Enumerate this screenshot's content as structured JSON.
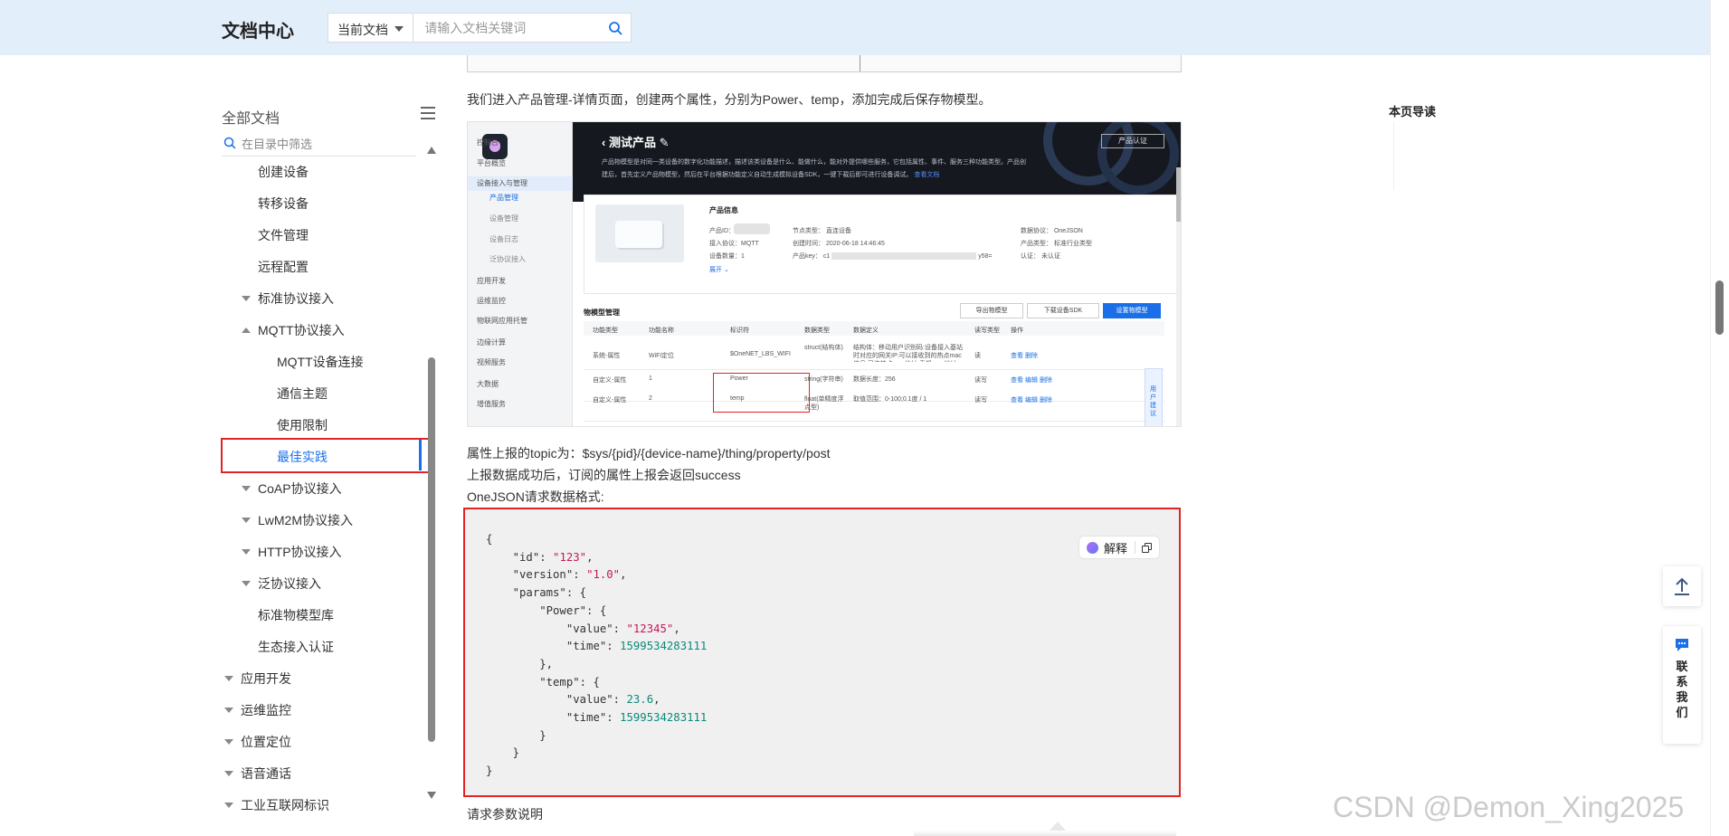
{
  "header": {
    "logo": "文档中心",
    "scope_label": "当前文档",
    "search_placeholder": "请输入文档关键词"
  },
  "sidebar": {
    "title": "全部文档",
    "filter_placeholder": "在目录中筛选",
    "items": [
      {
        "label": "创建设备",
        "indent": 2,
        "arrow": "none"
      },
      {
        "label": "转移设备",
        "indent": 2,
        "arrow": "none"
      },
      {
        "label": "文件管理",
        "indent": 2,
        "arrow": "none"
      },
      {
        "label": "远程配置",
        "indent": 2,
        "arrow": "none"
      },
      {
        "label": "标准协议接入",
        "indent": 2,
        "arrow": "down"
      },
      {
        "label": "MQTT协议接入",
        "indent": 2,
        "arrow": "up"
      },
      {
        "label": "MQTT设备连接",
        "indent": 3,
        "arrow": "none"
      },
      {
        "label": "通信主题",
        "indent": 3,
        "arrow": "none"
      },
      {
        "label": "使用限制",
        "indent": 3,
        "arrow": "none"
      },
      {
        "label": "最佳实践",
        "indent": 3,
        "arrow": "none",
        "active": true
      },
      {
        "label": "CoAP协议接入",
        "indent": 2,
        "arrow": "down"
      },
      {
        "label": "LwM2M协议接入",
        "indent": 2,
        "arrow": "down"
      },
      {
        "label": "HTTP协议接入",
        "indent": 2,
        "arrow": "down"
      },
      {
        "label": "泛协议接入",
        "indent": 2,
        "arrow": "down"
      },
      {
        "label": "标准物模型库",
        "indent": 2,
        "arrow": "none"
      },
      {
        "label": "生态接入认证",
        "indent": 2,
        "arrow": "none"
      },
      {
        "label": "应用开发",
        "indent": 1,
        "arrow": "down"
      },
      {
        "label": "运维监控",
        "indent": 1,
        "arrow": "down"
      },
      {
        "label": "位置定位",
        "indent": 1,
        "arrow": "down"
      },
      {
        "label": "语音通话",
        "indent": 1,
        "arrow": "down"
      },
      {
        "label": "工业互联网标识",
        "indent": 1,
        "arrow": "down"
      }
    ]
  },
  "content": {
    "intro": "我们进入产品管理-详情页面，创建两个属性，分别为Power、temp，添加完成后保存物模型。",
    "topic_line": "属性上报的topic为：$sys/{pid}/{device-name}/thing/property/post",
    "success_line": "上报数据成功后，订阅的属性上报会返回success",
    "format_line": "OneJSON请求数据格式:",
    "params_title": "请求参数说明",
    "explain_label": "解释",
    "code": {
      "id": "\"123\"",
      "version": "\"1.0\"",
      "power_value": "\"12345\"",
      "power_time": "1599534283111",
      "temp_value": "23.6",
      "temp_time": "1599534283111"
    }
  },
  "screenshot": {
    "product_title": "测试产品",
    "cert_button": "产品认证",
    "desc": "产品物模型是对同一类设备的数字化功能描述，描述该类设备是什么、能做什么，能对外提供哪些服务，它包括属性、事件、服务三种功能类型。产品创建后，首先定义产品物模型，然后在平台根据功能定义自动生成模拟设备SDK，一键下载后即可进行设备调试。",
    "desc_link": "查看文档",
    "nav": [
      {
        "label": "控制台",
        "type": "top"
      },
      {
        "label": "平台概览",
        "type": "top"
      },
      {
        "label": "设备接入与管理",
        "type": "group"
      },
      {
        "label": "产品管理",
        "type": "active"
      },
      {
        "label": "设备管理",
        "type": "sub"
      },
      {
        "label": "设备日志",
        "type": "sub"
      },
      {
        "label": "泛协议接入",
        "type": "sub"
      },
      {
        "label": "应用开发",
        "type": "group"
      },
      {
        "label": "运维监控",
        "type": "group"
      },
      {
        "label": "物联网应用托管",
        "type": "group"
      },
      {
        "label": "边缘计算",
        "type": "group"
      },
      {
        "label": "视频服务",
        "type": "group"
      },
      {
        "label": "大数据",
        "type": "group"
      },
      {
        "label": "增值服务",
        "type": "group"
      }
    ],
    "info_title": "产品信息",
    "info": {
      "pid_label": "产品ID：",
      "node_label": "节点类型：",
      "node_value": "直连设备",
      "data_label": "数据协议：",
      "data_value": "OneJSON",
      "access_label": "接入协议：",
      "access_value": "MQTT",
      "created_label": "创建时间：",
      "created_value": "2020-06-18 14:46:45",
      "category_label": "产品类型：",
      "category_value": "标准行业类型",
      "count_label": "设备数量：",
      "count_value": "1",
      "key_label": "产品key：",
      "key_value_start": "c1",
      "key_value_end": "y58=",
      "auth_label": "认证：",
      "auth_value": "未认证",
      "expand": "展开"
    },
    "tm_title": "物模型管理",
    "buttons": [
      "导出物模型",
      "下载设备SDK",
      "设置物模型"
    ],
    "columns": [
      "功能类型",
      "功能名称",
      "标识符",
      "数据类型",
      "数据定义",
      "读写类型",
      "操作"
    ],
    "rows": [
      {
        "type": "系统-属性",
        "name": "WiFi定位",
        "id": "$OneNET_LBS_WIFI",
        "dtype": "struct(结构体)",
        "def": "结构体：移动用户识别码:设备接入基站时对应的网关IP:可以接收到的热点mac信息:已连热点mac地址:手机mac地址iOS手机的idfa",
        "rw": "读",
        "ops": [
          "查看",
          "删除"
        ]
      },
      {
        "type": "自定义-属性",
        "name": "1",
        "id": "Power",
        "dtype": "string(字符串)",
        "def": "数据长度：256",
        "rw": "读写",
        "ops": [
          "查看",
          "编辑",
          "删除"
        ]
      },
      {
        "type": "自定义-属性",
        "name": "2",
        "id": "temp",
        "dtype": "float(单精度浮点型)",
        "def": "取值范围：0-100;0.1度 / 1",
        "rw": "读写",
        "ops": [
          "查看",
          "编辑",
          "删除"
        ]
      }
    ],
    "float_label": "用户建议"
  },
  "toc": {
    "title": "本页导读"
  },
  "float_panel": {
    "contact_label": "联系我们"
  },
  "watermark": "CSDN @Demon_Xing2025"
}
